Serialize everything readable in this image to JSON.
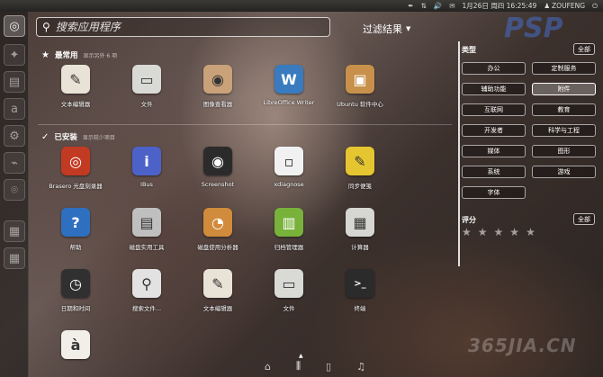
{
  "top_panel": {
    "date_time": "1月26日 周四 16:25:49",
    "username": "ZOUFENG"
  },
  "launcher": {
    "items": [
      "bfb",
      "ubuntu-software",
      "system-monitor",
      "amazon",
      "settings",
      "usb",
      "mouse",
      "workspace",
      "dash"
    ]
  },
  "search": {
    "placeholder": "搜索应用程序"
  },
  "filter_results": {
    "label": "过滤结果"
  },
  "sections": {
    "frequent": {
      "title": "最常用",
      "more": "显示另外 6 项"
    },
    "installed": {
      "title": "已安装",
      "more": "显示较少项目"
    }
  },
  "frequent_apps": [
    {
      "label": "文本编辑器",
      "icon": "text-editor-icon",
      "color": "#e8e3d6"
    },
    {
      "label": "文件",
      "icon": "files-icon",
      "color": "#d9d9d6"
    },
    {
      "label": "图像查看器",
      "icon": "image-viewer-icon",
      "color": "#c9a27a"
    },
    {
      "label": "LibreOffice Writer",
      "icon": "libreoffice-writer-icon",
      "color": "#3a7bbf"
    },
    {
      "label": "Ubuntu 软件中心",
      "icon": "software-center-icon",
      "color": "#c7914b"
    }
  ],
  "installed_apps": [
    {
      "label": "Brasero 光盘刻录器",
      "icon": "brasero-icon",
      "color": "#c33a23"
    },
    {
      "label": "IBus",
      "icon": "ibus-icon",
      "color": "#4d62c9"
    },
    {
      "label": "Screenshot",
      "icon": "screenshot-icon",
      "color": "#2b2b2b"
    },
    {
      "label": "xdiagnose",
      "icon": "xdiagnose-icon",
      "color": "#f1f1f1"
    },
    {
      "label": "同步便笺",
      "icon": "tomboy-icon",
      "color": "#e6c630"
    },
    {
      "label": "帮助",
      "icon": "help-icon",
      "color": "#2f6fc0"
    },
    {
      "label": "磁盘实用工具",
      "icon": "disk-utility-icon",
      "color": "#bfbfbf"
    },
    {
      "label": "磁盘使用分析器",
      "icon": "disk-usage-icon",
      "color": "#d18b3c"
    },
    {
      "label": "归档管理器",
      "icon": "archive-manager-icon",
      "color": "#78b23a"
    },
    {
      "label": "计算器",
      "icon": "calculator-icon",
      "color": "#d6d6d2"
    },
    {
      "label": "日期和时间",
      "icon": "clock-icon",
      "color": "#303030"
    },
    {
      "label": "搜索文件...",
      "icon": "search-files-icon",
      "color": "#e2e2e2"
    },
    {
      "label": "文本编辑器",
      "icon": "text-editor-icon",
      "color": "#e8e3d6"
    },
    {
      "label": "文件",
      "icon": "files-icon",
      "color": "#d9d9d6"
    },
    {
      "label": "终端",
      "icon": "terminal-icon",
      "color": "#2b2b2b"
    },
    {
      "label": "",
      "icon": "character-map-icon",
      "color": "#f1efe8"
    }
  ],
  "filters": {
    "type_label": "类型",
    "all_label": "全部",
    "categories": [
      "办公",
      "定制服务",
      "辅助功能",
      "附件",
      "互联网",
      "教育",
      "开发者",
      "科学与工程",
      "媒体",
      "图形",
      "系统",
      "游戏",
      "字体"
    ],
    "rating_label": "评分",
    "rating_all": "全部"
  },
  "lenses": [
    "home-icon",
    "applications-icon",
    "files-icon",
    "music-icon"
  ],
  "watermark": "365JIA.CN",
  "logo": "PSP"
}
